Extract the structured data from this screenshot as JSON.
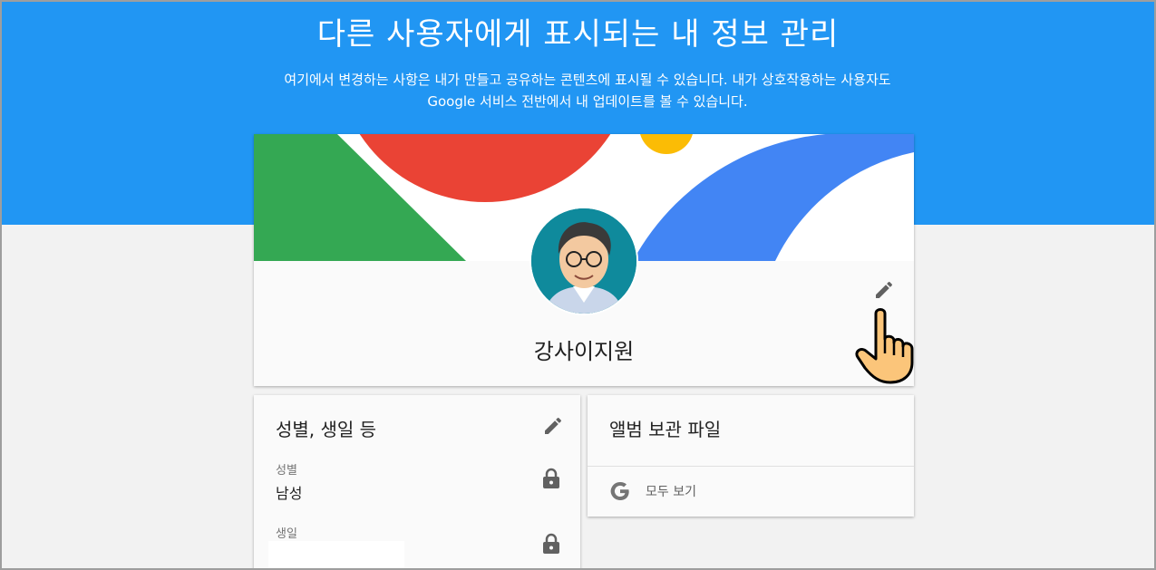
{
  "header": {
    "title": "다른 사용자에게 표시되는 내 정보 관리",
    "description": "여기에서 변경하는 사항은 내가 만들고 공유하는 콘텐츠에 표시될 수 있습니다. 내가 상호작용하는 사용자도 Google 서비스 전반에서 내 업데이트를 볼 수 있습니다."
  },
  "profile": {
    "name": "강사이지원"
  },
  "basic_info": {
    "title": "성별, 생일 등",
    "fields": [
      {
        "label": "성별",
        "value": "남성"
      },
      {
        "label": "생일",
        "value": ""
      }
    ]
  },
  "album": {
    "title": "앨범 보관 파일",
    "view_all": "모두 보기"
  },
  "colors": {
    "header_bg": "#2196f3",
    "google_red": "#ea4335",
    "google_green": "#34a853",
    "google_blue": "#4285f4",
    "google_yellow": "#fbbc05"
  },
  "icons": [
    "pencil-icon",
    "lock-icon",
    "google-g-icon",
    "pointer-hand-icon"
  ]
}
